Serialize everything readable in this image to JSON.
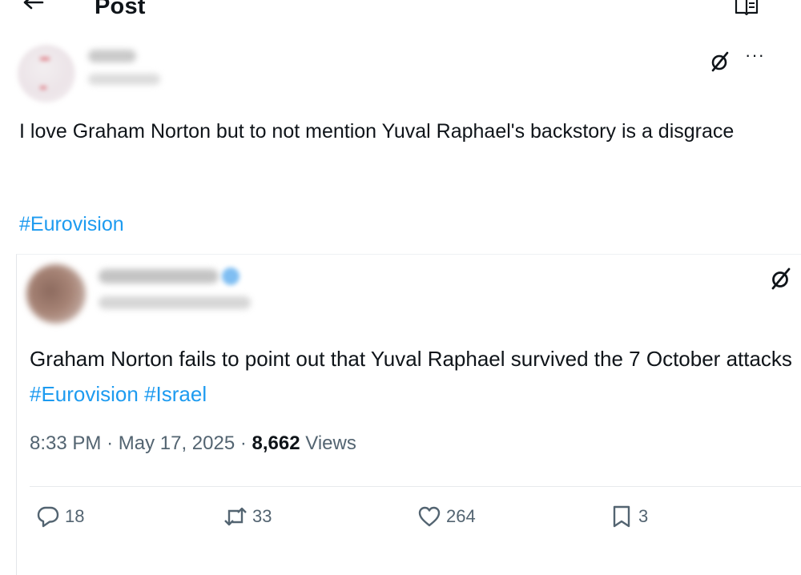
{
  "header": {
    "title": "Post",
    "back_icon": "arrow-left-icon",
    "reader_icon": "reader-mode-icon"
  },
  "post": {
    "text": "I love Graham Norton but to not mention Yuval Raphael's backstory is a disgrace",
    "hashtag": "#Eurovision",
    "icons": [
      "grok-icon",
      "more-icon"
    ],
    "more_label": "···"
  },
  "quoted_post": {
    "text_main": "Graham Norton fails to point out that Yuval Raphael survived the 7 October attacks",
    "hashtag_1": "#Eurovision",
    "hashtag_2": "#Israel",
    "time": "8:33 PM",
    "sep_1": "·",
    "date": "May 17, 2025",
    "sep_2": "·",
    "views_count": "8,662",
    "views_label": "Views",
    "actions": {
      "replies": "18",
      "reposts": "33",
      "likes": "264",
      "bookmarks": "3"
    }
  },
  "colors": {
    "accent": "#1d9bf0",
    "text": "#0f1419",
    "secondary": "#536471"
  }
}
